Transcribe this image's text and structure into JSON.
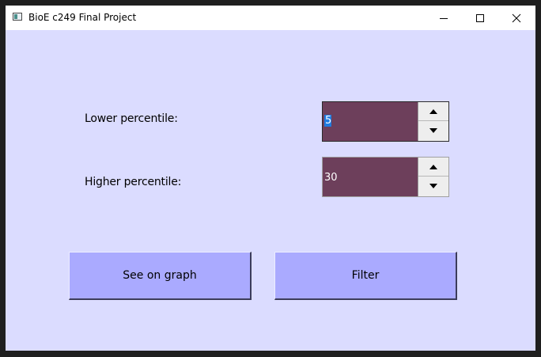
{
  "window": {
    "title": "BioE c249 Final Project"
  },
  "titlebar_controls": {
    "minimize_icon": "minimize-icon",
    "maximize_icon": "maximize-icon",
    "close_icon": "close-icon"
  },
  "form": {
    "lower_label": "Lower percentile:",
    "lower_value": "5",
    "higher_label": "Higher percentile:",
    "higher_value": "30"
  },
  "buttons": {
    "graph_label": "See on graph",
    "filter_label": "Filter"
  },
  "colors": {
    "background": "#dbdcff",
    "spinbox_fill": "#6d3f5b",
    "button_fill": "#aaaaff",
    "selection": "#1f7be0"
  }
}
